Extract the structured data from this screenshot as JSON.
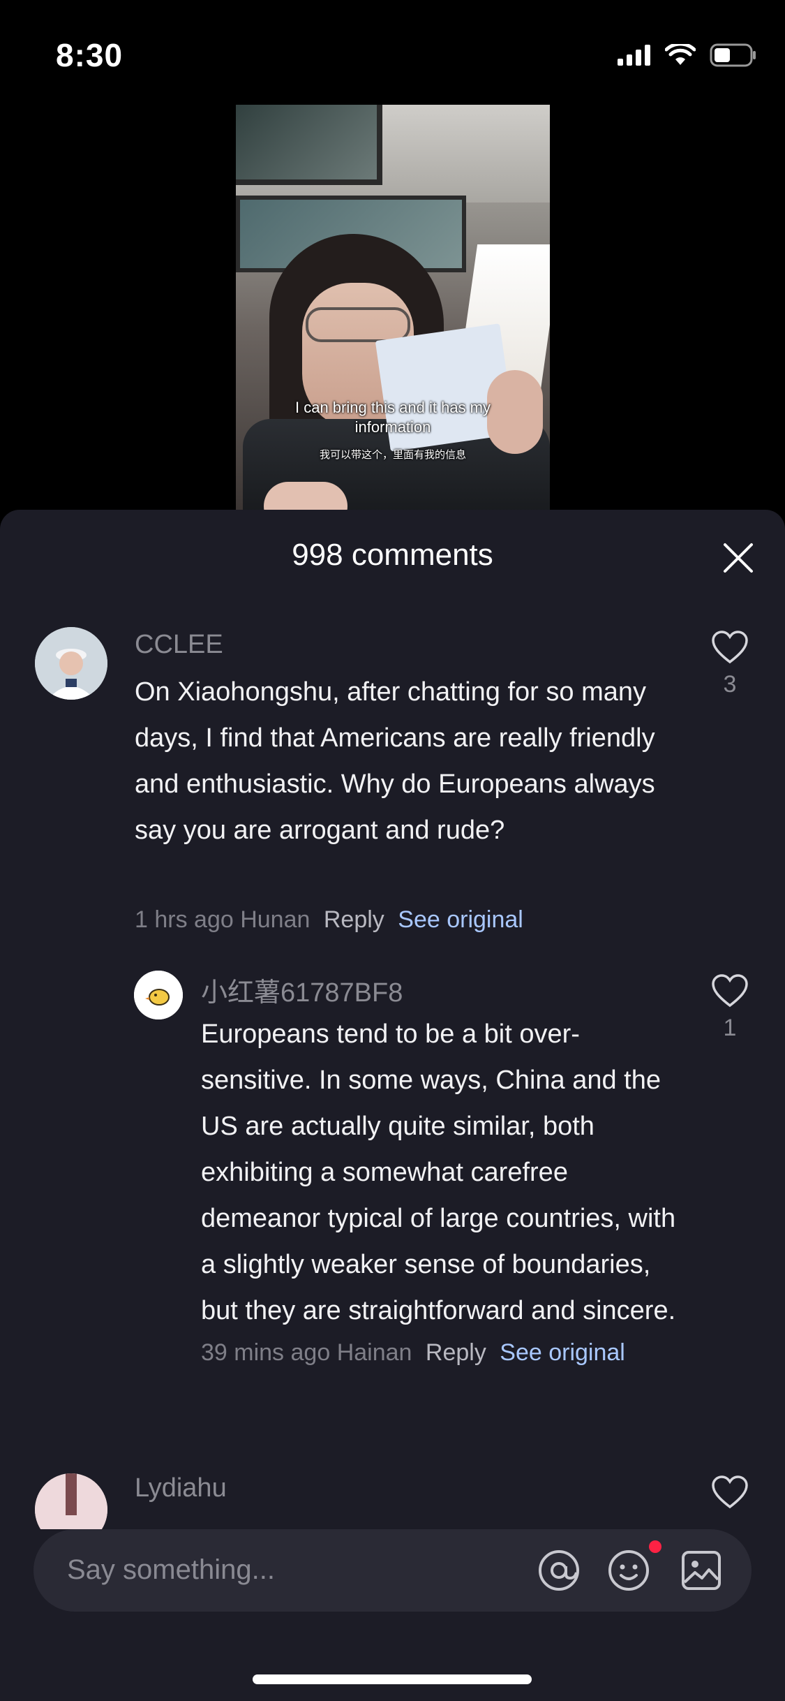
{
  "status_bar": {
    "time": "8:30"
  },
  "video": {
    "caption_en": "I can bring this and it has my information",
    "caption_zh": "我可以带这个，里面有我的信息"
  },
  "comments_sheet": {
    "title": "998 comments",
    "comments": [
      {
        "username": "CCLEE",
        "text": "On Xiaohongshu, after chatting for so many days, I find that Americans are really friendly and enthusiastic. Why do Europeans always say you are arrogant and rude?",
        "time": "1 hrs ago",
        "location": "Hunan",
        "reply_label": "Reply",
        "see_original_label": "See original",
        "likes": "3"
      },
      {
        "username": "小红薯61787BF8",
        "text": "Europeans tend to be a bit over-sensitive. In some ways, China and the US are actually quite similar, both exhibiting a somewhat carefree demeanor typical of large countries, with a slightly weaker sense of boundaries, but they are straightforward and sincere.",
        "time": "39 mins ago",
        "location": "Hainan",
        "reply_label": "Reply",
        "see_original_label": "See original",
        "likes": "1"
      },
      {
        "username": "Lydiahu"
      }
    ]
  },
  "input_bar": {
    "placeholder": "Say something..."
  },
  "colors": {
    "sheet_background": "#1c1c26",
    "link": "#a9c8ff",
    "notification_dot": "#ff2244"
  }
}
